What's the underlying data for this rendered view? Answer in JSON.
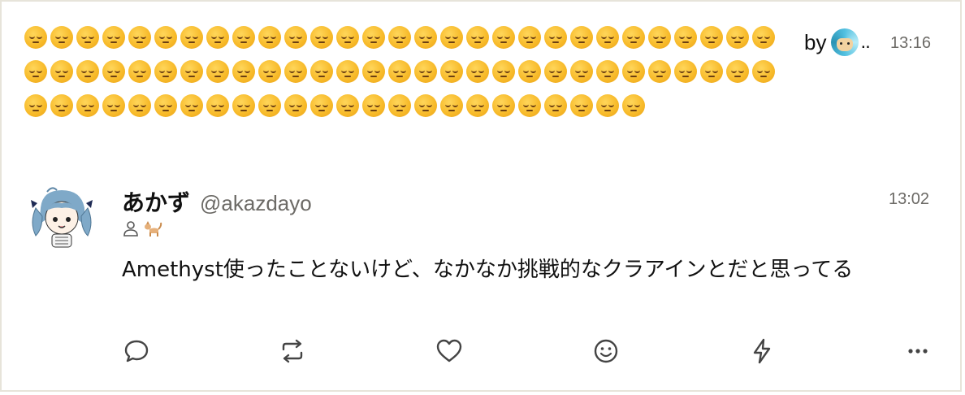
{
  "repost_header": {
    "emoji_name": "pensive-face",
    "emoji_count": 82,
    "by_label": "by",
    "by_ellipsis": "..",
    "time": "13:16"
  },
  "post": {
    "display_name": "あかず",
    "handle": "@akazdayo",
    "time": "13:02",
    "badges": [
      "person-icon",
      "cat-icon"
    ],
    "content": "Amethyst使ったことないけど、なかなか挑戦的なクラアインとだと思ってる"
  },
  "actions": {
    "reply_icon": "reply-icon",
    "repost_icon": "repost-icon",
    "like_icon": "heart-icon",
    "react_icon": "emoji-react-icon",
    "zap_icon": "zap-icon",
    "more_icon": "more-icon"
  },
  "colors": {
    "border": "#e7e4da",
    "muted_text": "#6c6a66",
    "icon": "#444444",
    "emoji": "#f7b928"
  }
}
